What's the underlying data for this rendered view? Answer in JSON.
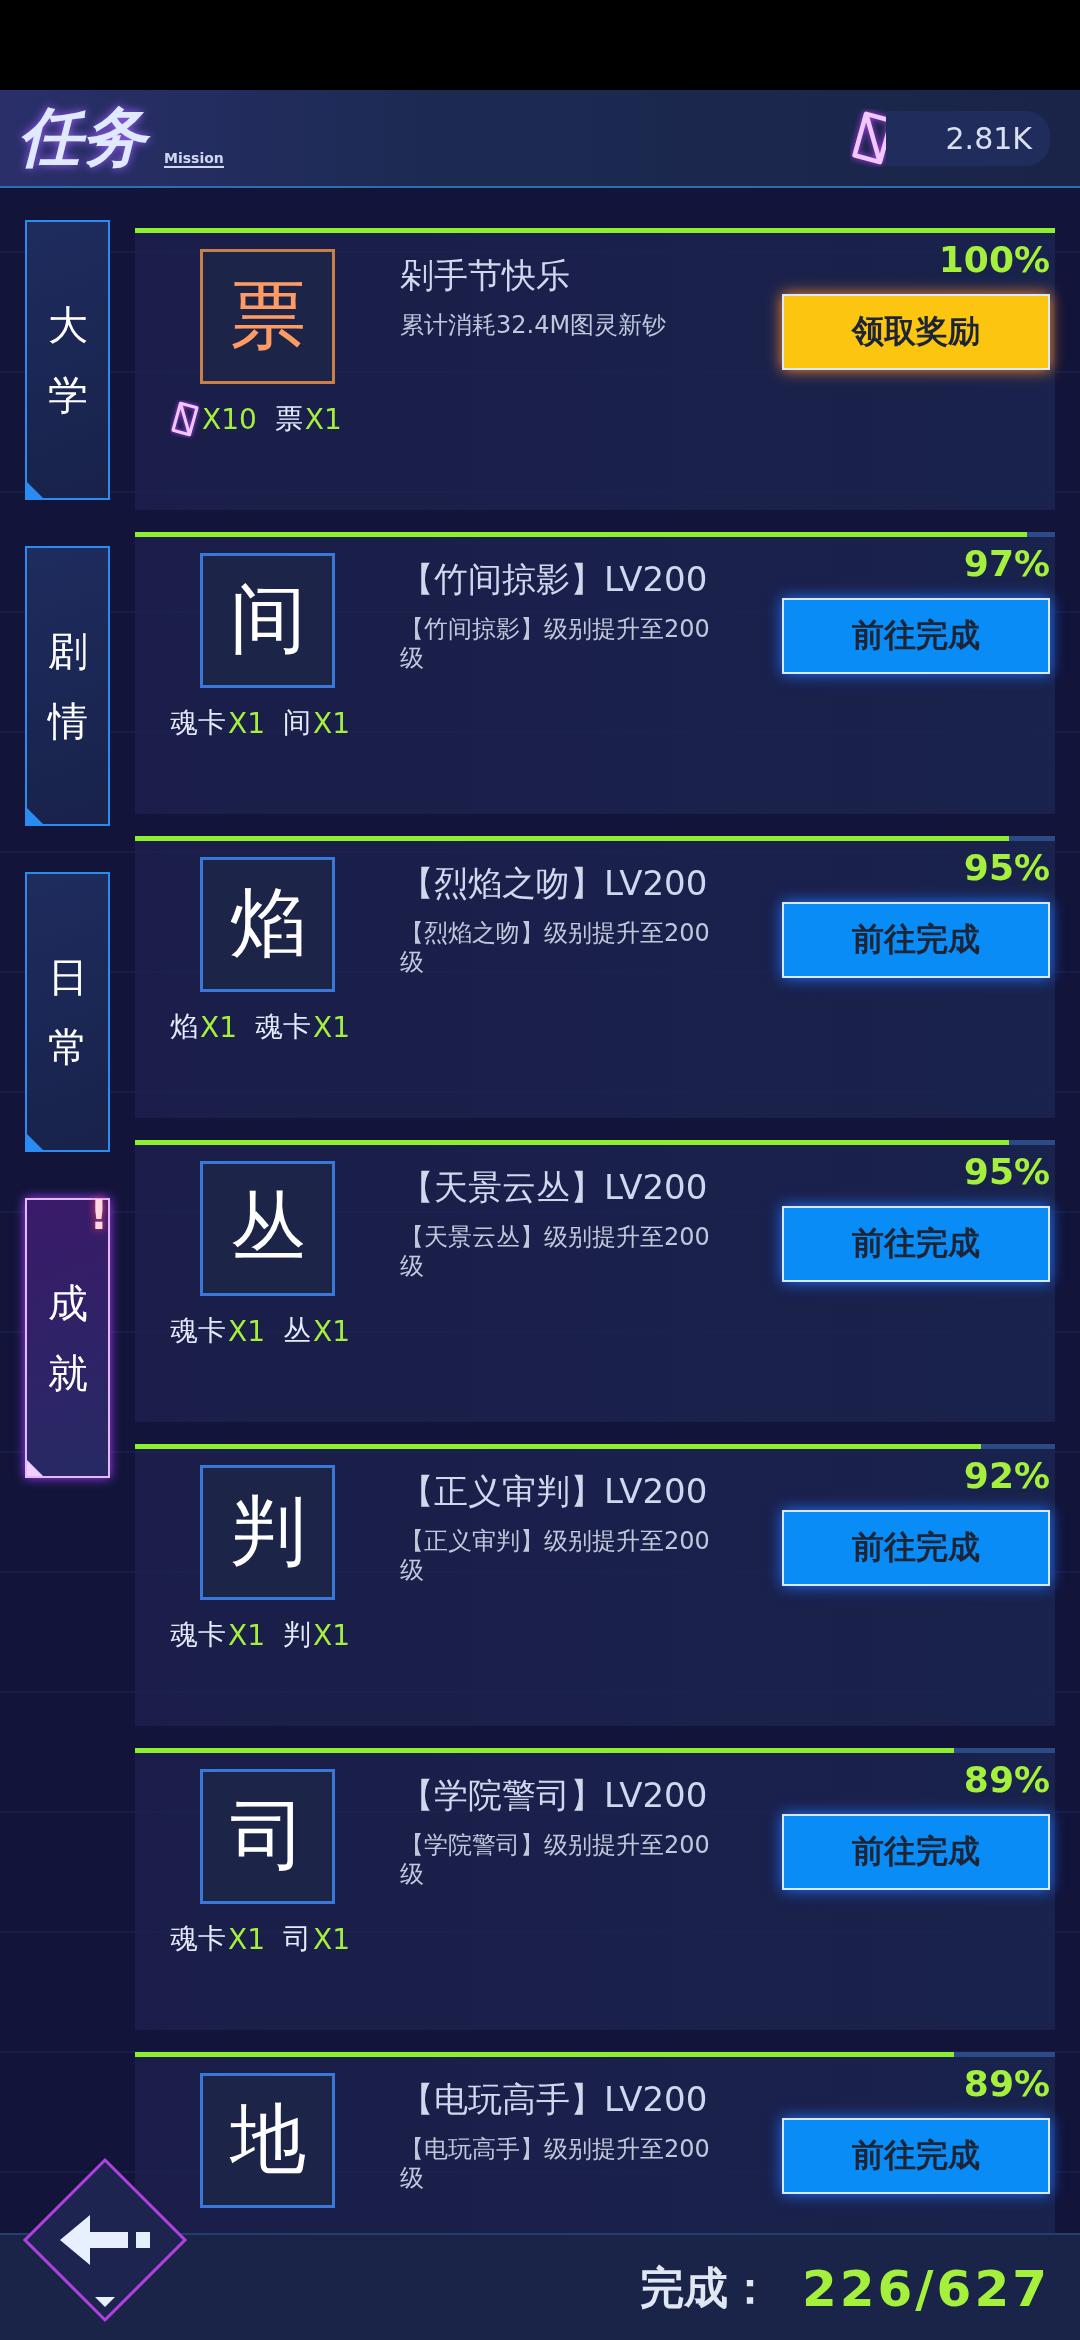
{
  "header": {
    "title": "任务",
    "subtitle": "Mission",
    "currency": "2.81K"
  },
  "tabs": [
    {
      "label": "大学",
      "selected": false
    },
    {
      "label": "剧情",
      "selected": false
    },
    {
      "label": "日常",
      "selected": false
    },
    {
      "label": "成就",
      "selected": true,
      "badge": "!"
    }
  ],
  "tasks": [
    {
      "kind": "claimable",
      "glyph": "票",
      "title": "剁手节快乐",
      "description": "累计消耗32.4M图灵新钞",
      "level": 1.0,
      "percent": "100%",
      "button": "领取奖励",
      "rewards": [
        {
          "kind": "crystal",
          "count": "X10"
        },
        {
          "kind": "item",
          "name": "票",
          "count": "X1"
        }
      ]
    },
    {
      "kind": "in_progress",
      "glyph": "间",
      "title": "【竹间掠影】LV200",
      "description": "【竹间掠影】级别提升至200级",
      "level": 0.97,
      "percent": "97%",
      "button": "前往完成",
      "rewards": [
        {
          "kind": "item",
          "name": "魂卡",
          "count": "X1"
        },
        {
          "kind": "item",
          "name": "间",
          "count": "X1"
        }
      ]
    },
    {
      "kind": "in_progress",
      "glyph": "焰",
      "title": "【烈焰之吻】LV200",
      "description": "【烈焰之吻】级别提升至200级",
      "level": 0.95,
      "percent": "95%",
      "button": "前往完成",
      "rewards": [
        {
          "kind": "item",
          "name": "焰",
          "count": "X1"
        },
        {
          "kind": "item",
          "name": "魂卡",
          "count": "X1"
        }
      ]
    },
    {
      "kind": "in_progress",
      "glyph": "丛",
      "title": "【天景云丛】LV200",
      "description": "【天景云丛】级别提升至200级",
      "level": 0.95,
      "percent": "95%",
      "button": "前往完成",
      "rewards": [
        {
          "kind": "item",
          "name": "魂卡",
          "count": "X1"
        },
        {
          "kind": "item",
          "name": "丛",
          "count": "X1"
        }
      ]
    },
    {
      "kind": "in_progress",
      "glyph": "判",
      "title": "【正义审判】LV200",
      "description": "【正义审判】级别提升至200级",
      "level": 0.92,
      "percent": "92%",
      "button": "前往完成",
      "rewards": [
        {
          "kind": "item",
          "name": "魂卡",
          "count": "X1"
        },
        {
          "kind": "item",
          "name": "判",
          "count": "X1"
        }
      ]
    },
    {
      "kind": "in_progress",
      "glyph": "司",
      "title": "【学院警司】LV200",
      "description": "【学院警司】级别提升至200级",
      "level": 0.89,
      "percent": "89%",
      "button": "前往完成",
      "rewards": [
        {
          "kind": "item",
          "name": "魂卡",
          "count": "X1"
        },
        {
          "kind": "item",
          "name": "司",
          "count": "X1"
        }
      ]
    },
    {
      "kind": "in_progress",
      "glyph": "地",
      "title": "【电玩高手】LV200",
      "description": "【电玩高手】级别提升至200级",
      "level": 0.89,
      "percent": "89%",
      "button": "前往完成"
    }
  ],
  "footer": {
    "label": "完成：",
    "progress": "226/627"
  }
}
